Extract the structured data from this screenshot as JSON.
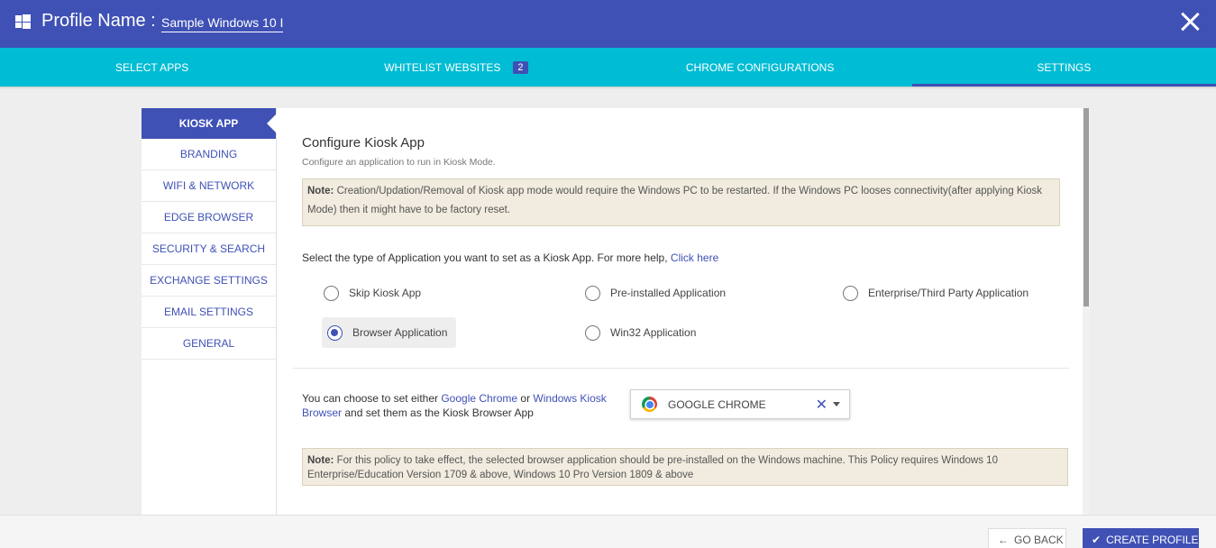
{
  "header": {
    "profile_label": "Profile Name :",
    "profile_name": "Sample Windows 10 I"
  },
  "tabs": [
    {
      "label": "SELECT APPS"
    },
    {
      "label": "WHITELIST WEBSITES",
      "badge": "2"
    },
    {
      "label": "CHROME CONFIGURATIONS"
    },
    {
      "label": "SETTINGS",
      "active": true
    }
  ],
  "sidebar": {
    "items": [
      {
        "label": "KIOSK APP"
      },
      {
        "label": "BRANDING"
      },
      {
        "label": "WIFI & NETWORK"
      },
      {
        "label": "EDGE BROWSER"
      },
      {
        "label": "SECURITY & SEARCH"
      },
      {
        "label": "EXCHANGE SETTINGS"
      },
      {
        "label": "EMAIL SETTINGS"
      },
      {
        "label": "GENERAL"
      }
    ]
  },
  "content": {
    "title": "Configure Kiosk App",
    "subtitle": "Configure an application to run in Kiosk Mode.",
    "note1_label": "Note:",
    "note1_text": " Creation/Updation/Removal of Kiosk app mode would require the Windows PC to be restarted. If the Windows PC looses connectivity(after applying Kiosk Mode) then it might have to be factory reset.",
    "select_question": "Select the type of Application you want to set as a Kiosk App. For more help, ",
    "click_here": "Click here",
    "options": {
      "skip": "Skip Kiosk App",
      "preinstalled": "Pre-installed Application",
      "enterprise": "Enterprise/Third Party Application",
      "browser": "Browser Application",
      "win32": "Win32 Application"
    },
    "browser_q_part1": "You can choose to set either ",
    "browser_q_link1": "Google Chrome",
    "browser_q_part2": " or ",
    "browser_q_link2": "Windows Kiosk Browser",
    "browser_q_part3": " and set them as the Kiosk Browser App",
    "browser_selected": "GOOGLE CHROME",
    "note2_label": "Note:",
    "note2_text": " For this policy to take effect, the selected browser application should be pre-installed on the Windows machine. This Policy requires Windows 10 Enterprise/Education Version 1709 & above, Windows 10 Pro Version 1809 & above"
  },
  "footer": {
    "go_back": "GO BACK",
    "create_profile": "CREATE PROFILE"
  }
}
